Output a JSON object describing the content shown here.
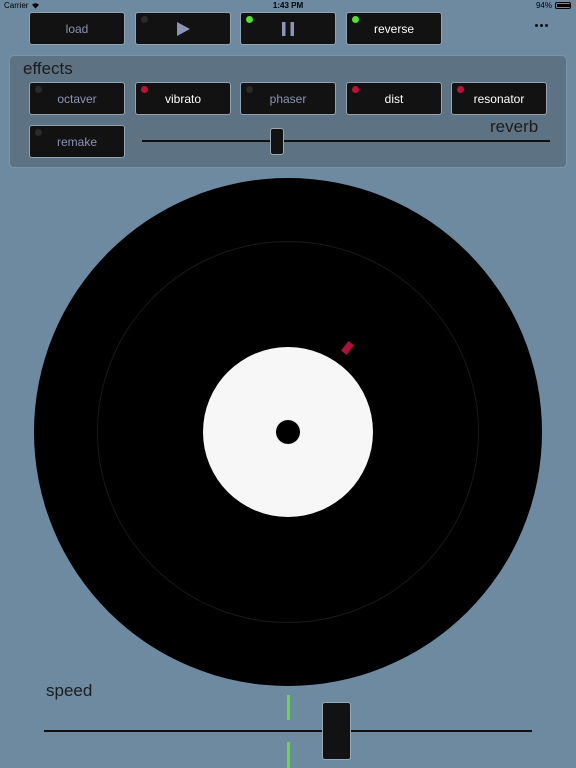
{
  "status": {
    "carrier": "Carrier",
    "time": "1:43 PM",
    "battery": "94%",
    "battery_level": 0.94
  },
  "toolbar": {
    "load": "load",
    "play_icon": "play-icon",
    "pause_icon": "pause-icon",
    "reverse": "reverse",
    "more_icon": "more-icon",
    "leds": {
      "play": "#2a2a2a",
      "pause": "#55e02a",
      "reverse": "#55e02a"
    }
  },
  "effects": {
    "title": "effects",
    "buttons": [
      {
        "label": "octaver",
        "active": false
      },
      {
        "label": "vibrato",
        "active": true
      },
      {
        "label": "phaser",
        "active": false
      },
      {
        "label": "dist",
        "active": true
      },
      {
        "label": "resonator",
        "active": true
      }
    ],
    "remake": {
      "label": "remake",
      "active": false
    },
    "reverb": {
      "label": "reverb",
      "value": 0.33
    }
  },
  "speed": {
    "label": "speed",
    "value": 0.6
  },
  "colors": {
    "background": "#6e8aa0",
    "led_on_red": "#c0103a",
    "led_on_green": "#55e02a",
    "led_off": "#2a2a2a",
    "center_line": "#66e02a"
  }
}
